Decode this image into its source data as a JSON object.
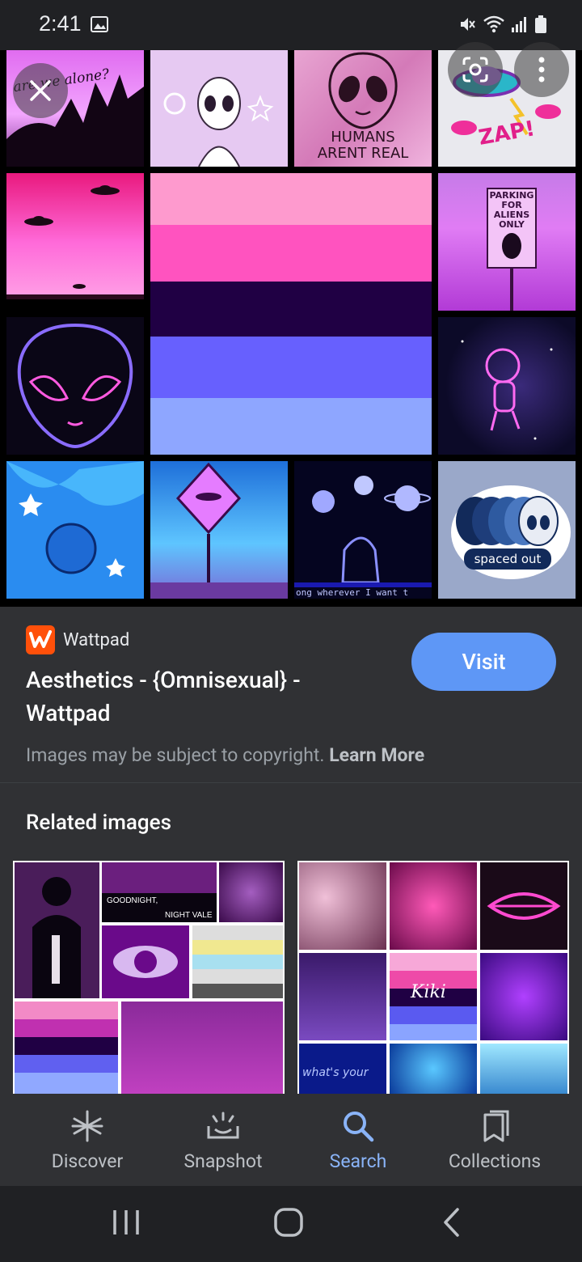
{
  "status_bar": {
    "time": "2:41"
  },
  "hero": {
    "tiles": {
      "alone_text": "are we alone?",
      "humans_line1": "HUMANS",
      "humans_line2": "ARENT REAL",
      "zap_text": "ZAP!",
      "parking_text": "PARKING FOR ALIENS ONLY",
      "wherever_text": "ong wherever I want t",
      "spaced_out_text": "spaced out"
    }
  },
  "source": {
    "site": "Wattpad",
    "title": "Aesthetics - {Omnisexual} - Wattpad",
    "visit_label": "Visit",
    "copyright_text": "Images may be subject to copyright.",
    "learn_more": "Learn More"
  },
  "related": {
    "heading": "Related images",
    "left_texts": [
      "GOODNIGHT,",
      "NIGHT VALE"
    ],
    "right_texts": [
      "Kiki",
      "what's your"
    ]
  },
  "bottom_nav": {
    "items": [
      {
        "label": "Discover",
        "icon": "asterisk-icon"
      },
      {
        "label": "Snapshot",
        "icon": "snapshot-icon"
      },
      {
        "label": "Search",
        "icon": "search-icon"
      },
      {
        "label": "Collections",
        "icon": "collections-icon"
      }
    ],
    "active": "Search",
    "active_color": "#8ab4f8"
  },
  "colors": {
    "visit_button": "#5e97f6",
    "panel": "#303134",
    "background": "#202124"
  }
}
